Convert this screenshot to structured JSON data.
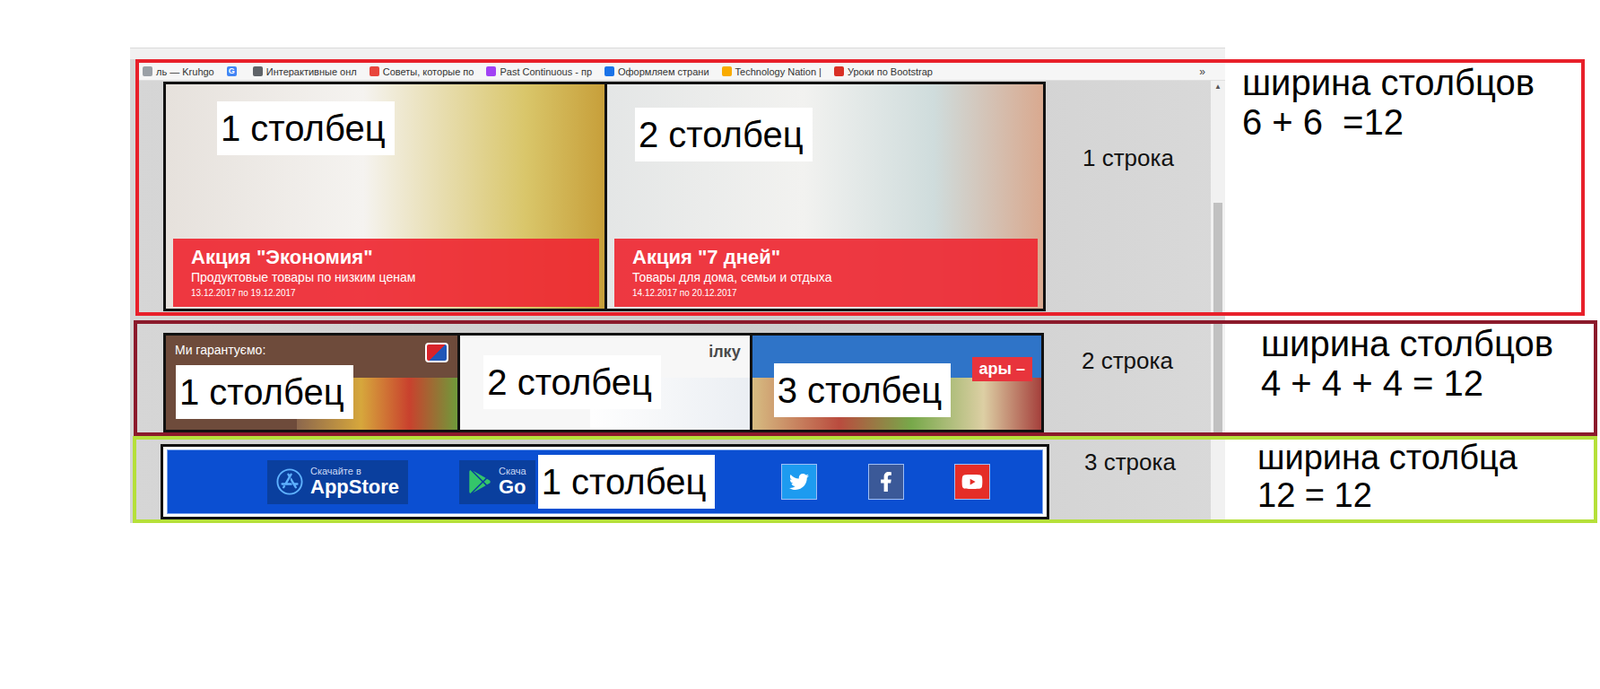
{
  "browser": {
    "bookmarks": [
      {
        "label": "ль — Kruhgo",
        "icon": "",
        "color": "#9aa0a6"
      },
      {
        "label": "",
        "icon": "G",
        "color": "#4285f4"
      },
      {
        "label": "Интерактивные онл",
        "icon": "",
        "color": "#5f6368"
      },
      {
        "label": "Советы, которые по",
        "icon": "",
        "color": "#e8453c"
      },
      {
        "label": "Past Continuous - пр",
        "icon": "",
        "color": "#a142f4"
      },
      {
        "label": "Оформляем страни",
        "icon": "",
        "color": "#1a73e8"
      },
      {
        "label": "Technology Nation | ",
        "icon": "",
        "color": "#f9ab00"
      },
      {
        "label": "Уроки по Bootstrap",
        "icon": "",
        "color": "#d93025"
      }
    ],
    "overflow": "»",
    "scroll_arrow": "▲"
  },
  "rows": [
    {
      "label": "1 строка",
      "border_color": "#e8202a",
      "scroll_thumb": 0.5,
      "annotation": {
        "title": "ширина столбцов",
        "formula": [
          "6 + 6",
          "=12"
        ]
      },
      "columns": [
        {
          "label": "1 столбец",
          "kind": "promo",
          "title": "Акция \"Экономия\"",
          "subtitle": "Продуктовые товары по низким ценам",
          "dates": "13.12.2017 по 19.12.2017"
        },
        {
          "label": "2 столбец",
          "kind": "promo",
          "title": "Акция \"7 дней\"",
          "subtitle": "Товары для дома, семьи и отдыха",
          "dates": "14.12.2017 по 20.12.2017"
        }
      ]
    },
    {
      "label": "2 строка",
      "border_color": "#8b1a2b",
      "scroll_thumb": 1,
      "annotation": {
        "title": "ширина столбцов",
        "formula": [
          "4 + 4 + 4 = 12"
        ]
      },
      "columns": [
        {
          "label": "1 столбец",
          "kind": "banner",
          "caption": "Ми гарантуємо:",
          "color": "#6e4b3b"
        },
        {
          "label": "2 столбец",
          "kind": "banner",
          "caption": "ілку",
          "color": "#f7f7f7"
        },
        {
          "label": "3 столбец",
          "kind": "banner",
          "caption": "ары –",
          "color": "#2f74c8"
        }
      ]
    },
    {
      "label": "3 строка",
      "border_color": "#b5e03a",
      "scroll_thumb": 0,
      "annotation": {
        "title": "ширина столбца",
        "formula": [
          "12 = 12"
        ]
      },
      "columns": [
        {
          "label": "1 столбец",
          "kind": "apps",
          "stores": [
            {
              "caption": "Скачайте в",
              "name": "AppStore"
            },
            {
              "caption": "Скача",
              "name": "Go"
            }
          ]
        }
      ]
    }
  ]
}
